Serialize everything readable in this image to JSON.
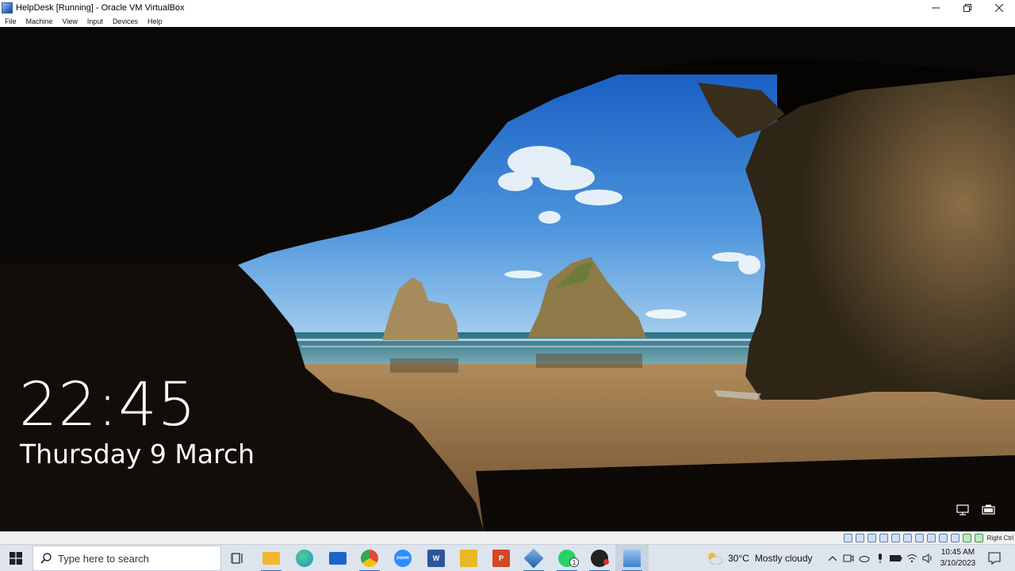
{
  "window": {
    "title": "HelpDesk [Running] - Oracle VM VirtualBox",
    "minimize_icon": "minimize-icon",
    "restore_icon": "restore-icon",
    "close_icon": "close-icon"
  },
  "menu": [
    "File",
    "Machine",
    "View",
    "Input",
    "Devices",
    "Help"
  ],
  "lockscreen": {
    "time": "22:45",
    "date": "Thursday 9 March"
  },
  "vbox_status": {
    "host_key": "Right Ctrl"
  },
  "taskbar": {
    "search_placeholder": "Type here to search",
    "apps": [
      {
        "name": "task-view",
        "icon": "task-view-icon"
      },
      {
        "name": "file-explorer",
        "icon": "folder-icon",
        "color": "#f2b72e"
      },
      {
        "name": "edge",
        "icon": "edge-icon",
        "color": "#1f8fd1"
      },
      {
        "name": "mail",
        "icon": "mail-icon",
        "color": "#1d64c6"
      },
      {
        "name": "chrome",
        "icon": "chrome-icon",
        "color": "#e04a3a"
      },
      {
        "name": "zoom",
        "icon": "zoom-icon",
        "label": "zoom",
        "color": "#2d8cff"
      },
      {
        "name": "word",
        "icon": "word-icon",
        "label": "W",
        "color": "#2b579a"
      },
      {
        "name": "sticky-tool",
        "icon": "notes-icon",
        "color": "#e8b926"
      },
      {
        "name": "powerpoint",
        "icon": "powerpoint-icon",
        "label": "P",
        "color": "#d24726"
      },
      {
        "name": "virtualbox",
        "icon": "virtualbox-icon",
        "color": "#1e5fa8"
      },
      {
        "name": "whatsapp",
        "icon": "whatsapp-icon",
        "badge": "1",
        "color": "#25d366"
      },
      {
        "name": "obs",
        "icon": "record-icon",
        "color": "#222222"
      },
      {
        "name": "helpdesk-vm",
        "icon": "vm-window-icon",
        "color": "#3a7fd1"
      }
    ],
    "weather": {
      "temp": "30°C",
      "desc": "Mostly cloudy"
    },
    "tray_time": "10:45 AM",
    "tray_date": "3/10/2023"
  }
}
